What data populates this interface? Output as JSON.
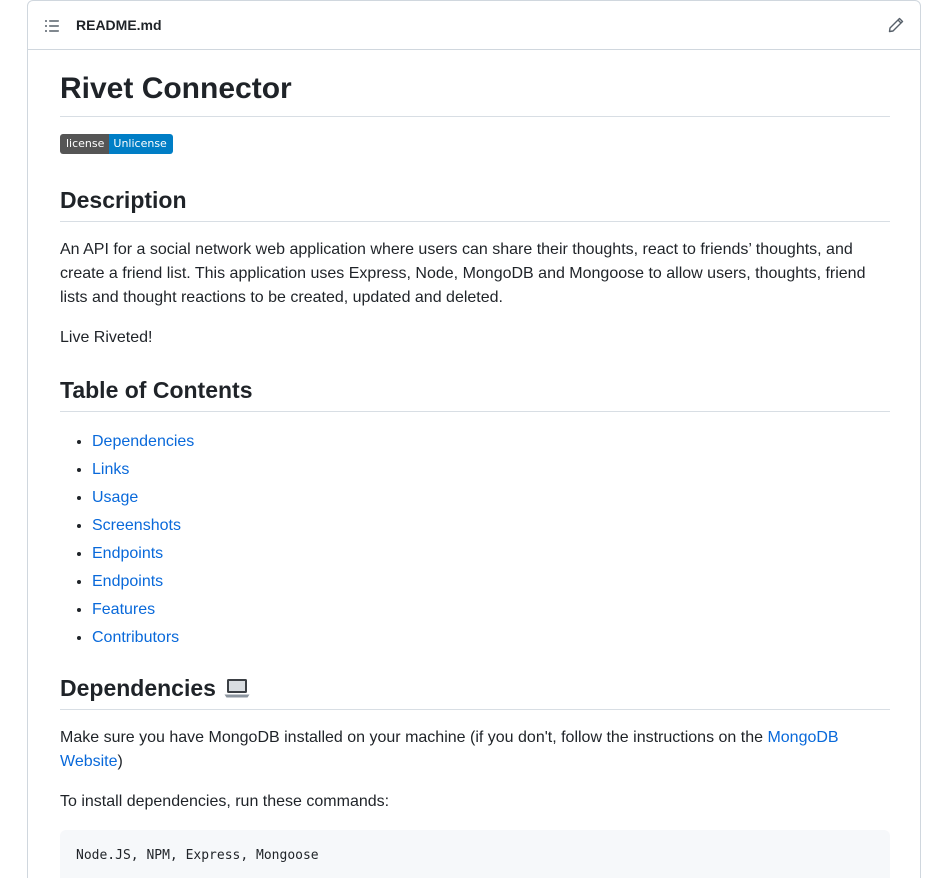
{
  "header": {
    "filename": "README.md",
    "toc_icon": "list-unordered-icon",
    "edit_icon": "pencil-icon"
  },
  "readme": {
    "title": "Rivet Connector",
    "badge": {
      "label": "license",
      "value": "Unlicense",
      "label_color": "#555555",
      "value_color": "#007ec6"
    },
    "description": {
      "heading": "Description",
      "paragraph": "An API for a social network web application where users can share their thoughts, react to friends’ thoughts, and create a friend list. This application uses Express, Node, MongoDB and Mongoose to allow users, thoughts, friend lists and thought reactions to be created, updated and deleted.",
      "tagline": "Live Riveted!"
    },
    "toc": {
      "heading": "Table of Contents",
      "items": [
        "Dependencies",
        "Links",
        "Usage",
        "Screenshots",
        "Endpoints",
        "Endpoints",
        "Features",
        "Contributors"
      ]
    },
    "dependencies": {
      "heading": "Dependencies",
      "heading_icon": "laptop-icon",
      "intro_before_link": "Make sure you have MongoDB installed on your machine (if you don't, follow the instructions on the ",
      "link_text": "MongoDB Website",
      "intro_after_link": ")",
      "install_text": "To install dependencies, run these commands:",
      "code": "Node.JS, NPM, Express, Mongoose"
    }
  },
  "colors": {
    "link": "#0969da",
    "text": "#1f2328",
    "border": "#d0d7de",
    "code_bg": "#f6f8fa"
  }
}
